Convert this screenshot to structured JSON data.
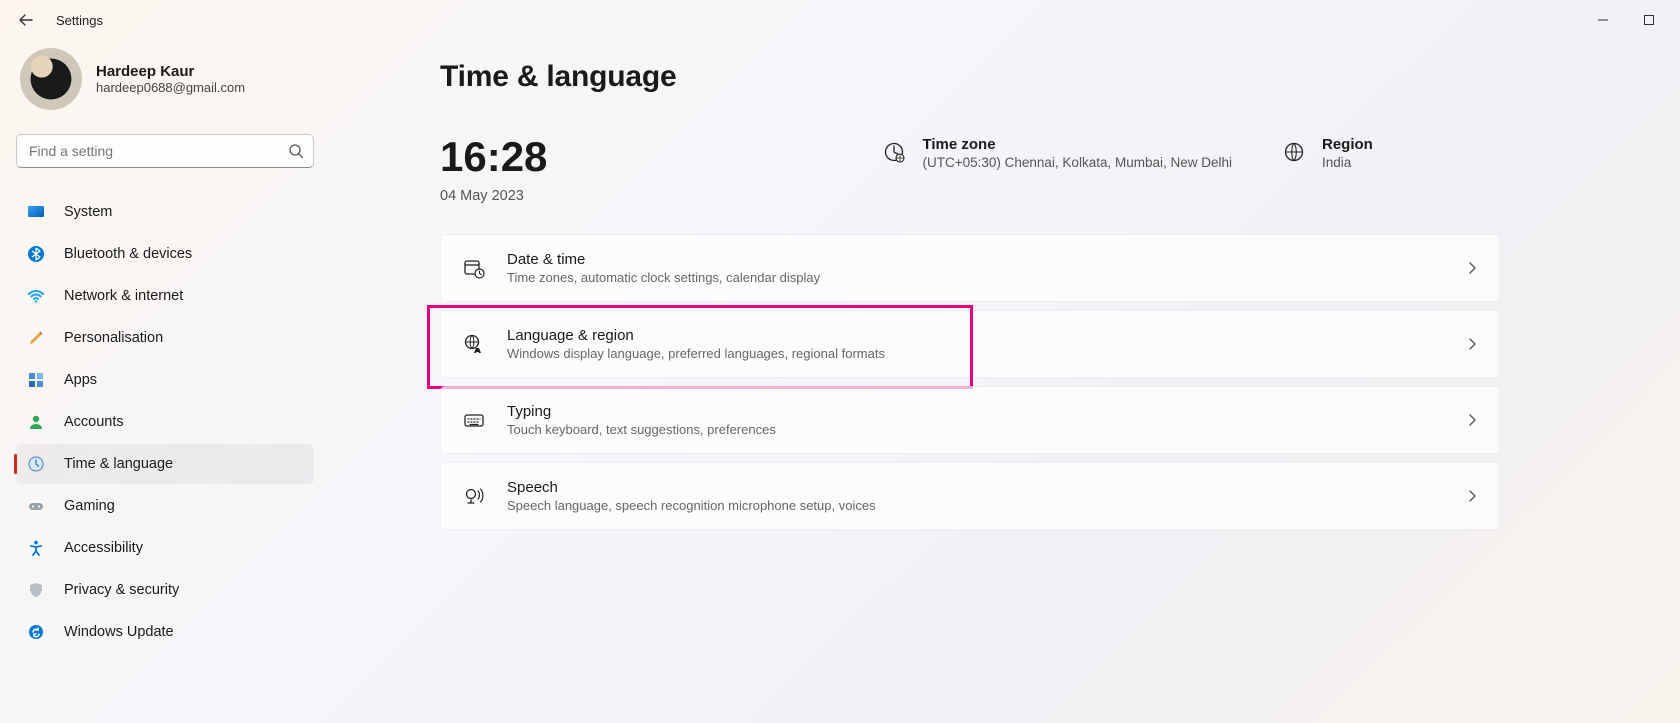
{
  "app_title": "Settings",
  "user": {
    "name": "Hardeep Kaur",
    "email": "hardeep0688@gmail.com"
  },
  "search": {
    "placeholder": "Find a setting"
  },
  "nav": {
    "items": [
      {
        "label": "System"
      },
      {
        "label": "Bluetooth & devices"
      },
      {
        "label": "Network & internet"
      },
      {
        "label": "Personalisation"
      },
      {
        "label": "Apps"
      },
      {
        "label": "Accounts"
      },
      {
        "label": "Time & language"
      },
      {
        "label": "Gaming"
      },
      {
        "label": "Accessibility"
      },
      {
        "label": "Privacy & security"
      },
      {
        "label": "Windows Update"
      }
    ],
    "selected_index": 6
  },
  "page": {
    "title": "Time & language",
    "time": "16:28",
    "date": "04 May 2023",
    "timezone": {
      "label": "Time zone",
      "value": "(UTC+05:30) Chennai, Kolkata, Mumbai, New Delhi"
    },
    "region": {
      "label": "Region",
      "value": "India"
    },
    "cards": [
      {
        "title": "Date & time",
        "desc": "Time zones, automatic clock settings, calendar display"
      },
      {
        "title": "Language & region",
        "desc": "Windows display language, preferred languages, regional formats"
      },
      {
        "title": "Typing",
        "desc": "Touch keyboard, text suggestions, preferences"
      },
      {
        "title": "Speech",
        "desc": "Speech language, speech recognition microphone setup, voices"
      }
    ],
    "highlight_index": 1
  }
}
